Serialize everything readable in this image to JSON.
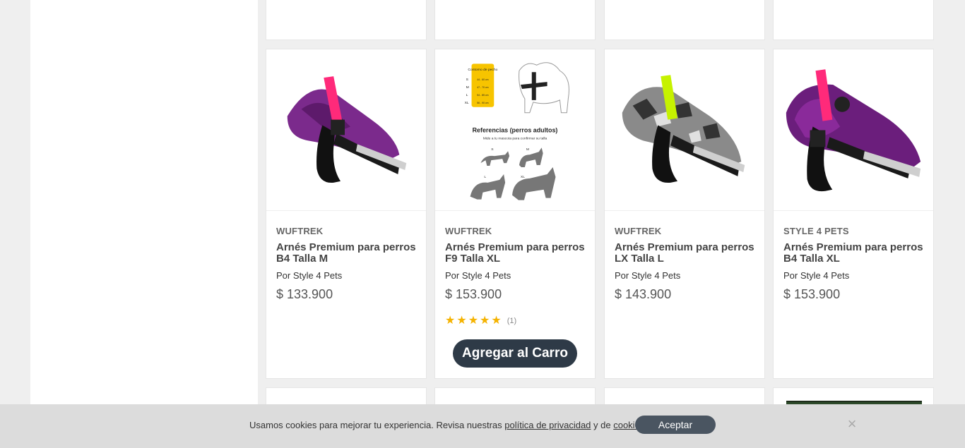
{
  "products": [
    {
      "brand": "WUFTREK",
      "title": "Arnés Premium para perros B4 Talla M",
      "seller": "Por Style 4 Pets",
      "price": "$ 133.900",
      "image": "harness-purple-pink"
    },
    {
      "brand": "WUFTREK",
      "title": "Arnés Premium para perros F9 Talla XL",
      "seller": "Por Style 4 Pets",
      "price": "$ 153.900",
      "image": "size-guide",
      "rating": 5,
      "rating_count": "(1)",
      "add_button": "Agregar al Carro",
      "size_guide": {
        "header": "Contorno de pecho",
        "sizes": [
          "S",
          "M",
          "L",
          "XL"
        ],
        "ranges": [
          "44 - 60 cm",
          "47 - 70 cm",
          "54 - 85 cm",
          "56 - 90 cm"
        ],
        "caption": "Referencias (perros adultos)",
        "subcaption": "Mide a tu mascota para confirmar su talla",
        "dog_labels": [
          "S",
          "M",
          "L",
          "XL"
        ]
      }
    },
    {
      "brand": "WUFTREK",
      "title": "Arnés Premium para perros LX Talla L",
      "seller": "Por Style 4 Pets",
      "price": "$ 143.900",
      "image": "harness-camo-green"
    },
    {
      "brand": "STYLE 4 PETS",
      "title": "Arnés Premium para perros B4 Talla XL",
      "seller": "Por Style 4 Pets",
      "price": "$ 153.900",
      "image": "harness-purple-pink"
    }
  ],
  "cookie": {
    "text_before": "Usamos cookies para mejorar tu experiencia. Revisa nuestras ",
    "privacy_link": "política de privacidad",
    "text_middle": " y de ",
    "cookies_link": "cookies",
    "text_after": ".",
    "accept": "Aceptar",
    "close_icon": "close-icon"
  },
  "colors": {
    "button_dark": "#2e3a47",
    "star": "#f5b301",
    "cookie_bg": "#dcdcdc"
  }
}
